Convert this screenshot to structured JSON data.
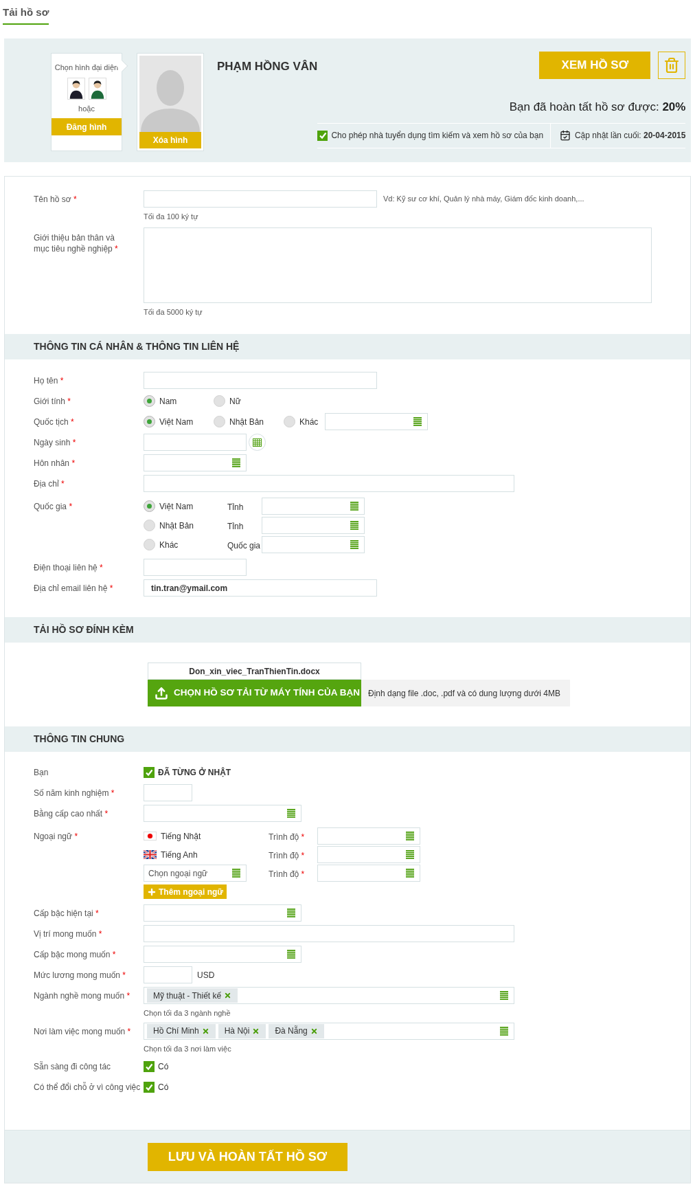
{
  "tabs": [
    {
      "label": "Tải hồ sơ",
      "selected": true
    }
  ],
  "header": {
    "avatar_chooser": {
      "title": "Chọn hình đại diện",
      "separator": "hoặc",
      "upload_button": "Đăng hình"
    },
    "photo": {
      "delete_button": "Xóa hình"
    },
    "name": "PHẠM HỒNG VÂN",
    "view_button": "XEM HỒ SƠ",
    "completion": "Bạn đã hoàn tất hồ sơ được: **20%**",
    "allow_search": {
      "label": "Cho phép nhà tuyển dụng tìm kiếm và xem hồ sơ của bạn",
      "checked": true
    },
    "last_updated": "Cập nhật lần cuối: **20-04-2015**"
  },
  "sections": [
    {
      "rows": [
        {
          "label": "Tên hồ sơ",
          "mark": "*",
          "kind": "text",
          "example": "Vd: Kỹ sư cơ khí, Quản lý nhà máy, Giám đốc kinh doanh,...",
          "hint": "Tối đa 100 ký tự"
        },
        {
          "label": "Giới thiệu bản thân và mục tiêu nghề nghiệp",
          "mark": "*",
          "kind": "textarea",
          "hint": "Tối đa 5000 ký tự"
        }
      ]
    },
    {
      "title": "THÔNG TIN CÁ NHÂN & THÔNG TIN LIÊN HỆ",
      "rows": [
        {
          "label": "Họ tên",
          "mark": "*",
          "kind": "text"
        },
        {
          "label": "Giới tính",
          "mark": "*",
          "kind": "radio",
          "options": [
            {
              "label": "Nam",
              "selected": true
            },
            {
              "label": "Nữ",
              "selected": false
            }
          ]
        },
        {
          "label": "Quốc tịch",
          "mark": "*",
          "kind": "radio",
          "options": [
            {
              "label": "Việt Nam",
              "selected": true
            },
            {
              "label": "Nhật Bản",
              "selected": false
            },
            {
              "label": "Khác",
              "selected": false
            }
          ],
          "select": true
        },
        {
          "label": "Ngày sinh",
          "mark": "*",
          "kind": "date"
        },
        {
          "label": "Hôn nhân",
          "mark": "*",
          "kind": "select"
        },
        {
          "label": "Địa chỉ",
          "mark": "*",
          "kind": "text"
        },
        {
          "label": "Quốc gia",
          "mark": "*",
          "kind": "radio_rows",
          "options": [
            {
              "label": "Việt Nam",
              "selected": true,
              "field_label": "Tỉnh"
            },
            {
              "label": "Nhật Bản",
              "selected": false,
              "field_label": "Tỉnh"
            },
            {
              "label": "Khác",
              "selected": false,
              "field_label": "Quốc gia"
            }
          ]
        },
        {
          "label": "Điện thoại liên hệ",
          "mark": "*",
          "kind": "text"
        },
        {
          "label": "Địa chỉ email liên hệ",
          "mark": "*",
          "kind": "text",
          "value": "tin.tran@ymail.com"
        }
      ]
    },
    {
      "title": "TẢI HỒ SƠ ĐÍNH KÈM",
      "attachment": {
        "file_name": "Don_xin_viec_TranThienTin.docx",
        "upload_button": "CHỌN HỒ SƠ TẢI TỪ MÁY TÍNH CỦA BẠN",
        "note": "Định dạng file .doc, .pdf và có dung lượng dưới 4MB"
      }
    },
    {
      "title": "THÔNG TIN CHUNG",
      "rows": [
        {
          "label": "Bạn",
          "kind": "checkbox",
          "text": "ĐÃ TỪNG Ở NHẬT",
          "checked": true,
          "emphasis": true
        },
        {
          "label": "Số năm kinh nghiệm",
          "mark": "*",
          "kind": "text"
        },
        {
          "label": "Bằng cấp cao nhất",
          "mark": "*",
          "kind": "select"
        },
        {
          "label": "Ngoại ngữ",
          "mark": "*",
          "kind": "languages",
          "languages": [
            {
              "kind": "japan",
              "name": "Tiếng Nhật",
              "level_label": "Trình độ",
              "level_mark": "*"
            },
            {
              "kind": "uk",
              "name": "Tiếng Anh",
              "level_label": "Trình độ",
              "level_mark": "*"
            },
            {
              "kind": "select",
              "placeholder": "Chọn ngoại ngữ",
              "level_label": "Trình độ",
              "level_mark": "*"
            }
          ],
          "add_button": "Thêm ngoại ngữ"
        },
        {
          "label": "Cấp bậc hiện tại",
          "mark": "*",
          "kind": "select"
        },
        {
          "label": "Vị trí mong muốn",
          "mark": "*",
          "kind": "text"
        },
        {
          "label": "Cấp bậc mong muốn",
          "mark": "*",
          "kind": "select"
        },
        {
          "label": "Mức lương mong muốn",
          "mark": "*",
          "kind": "text",
          "suffix": "USD"
        },
        {
          "label": "Ngành nghề mong muốn",
          "mark": "*",
          "kind": "tags",
          "tags": [
            "Mỹ thuật - Thiết kế"
          ],
          "hint": "Chọn tối đa 3 ngành nghề"
        },
        {
          "label": "Nơi làm việc mong muốn",
          "mark": "*",
          "kind": "tags",
          "tags": [
            "Hồ Chí Minh",
            "Hà Nội",
            "Đà Nẵng"
          ],
          "hint": "Chọn tối đa 3 nơi làm việc"
        },
        {
          "label": "Sẵn sàng đi công tác",
          "kind": "checkbox",
          "text": "Có",
          "checked": true,
          "emphasis": false
        },
        {
          "label": "Có thể đổi chỗ ở vì công việc",
          "kind": "checkbox",
          "text": "Có",
          "checked": true,
          "emphasis": false
        }
      ]
    }
  ],
  "footer": {
    "save_button": "LƯU VÀ HOÀN TẤT HỒ SƠ"
  }
}
